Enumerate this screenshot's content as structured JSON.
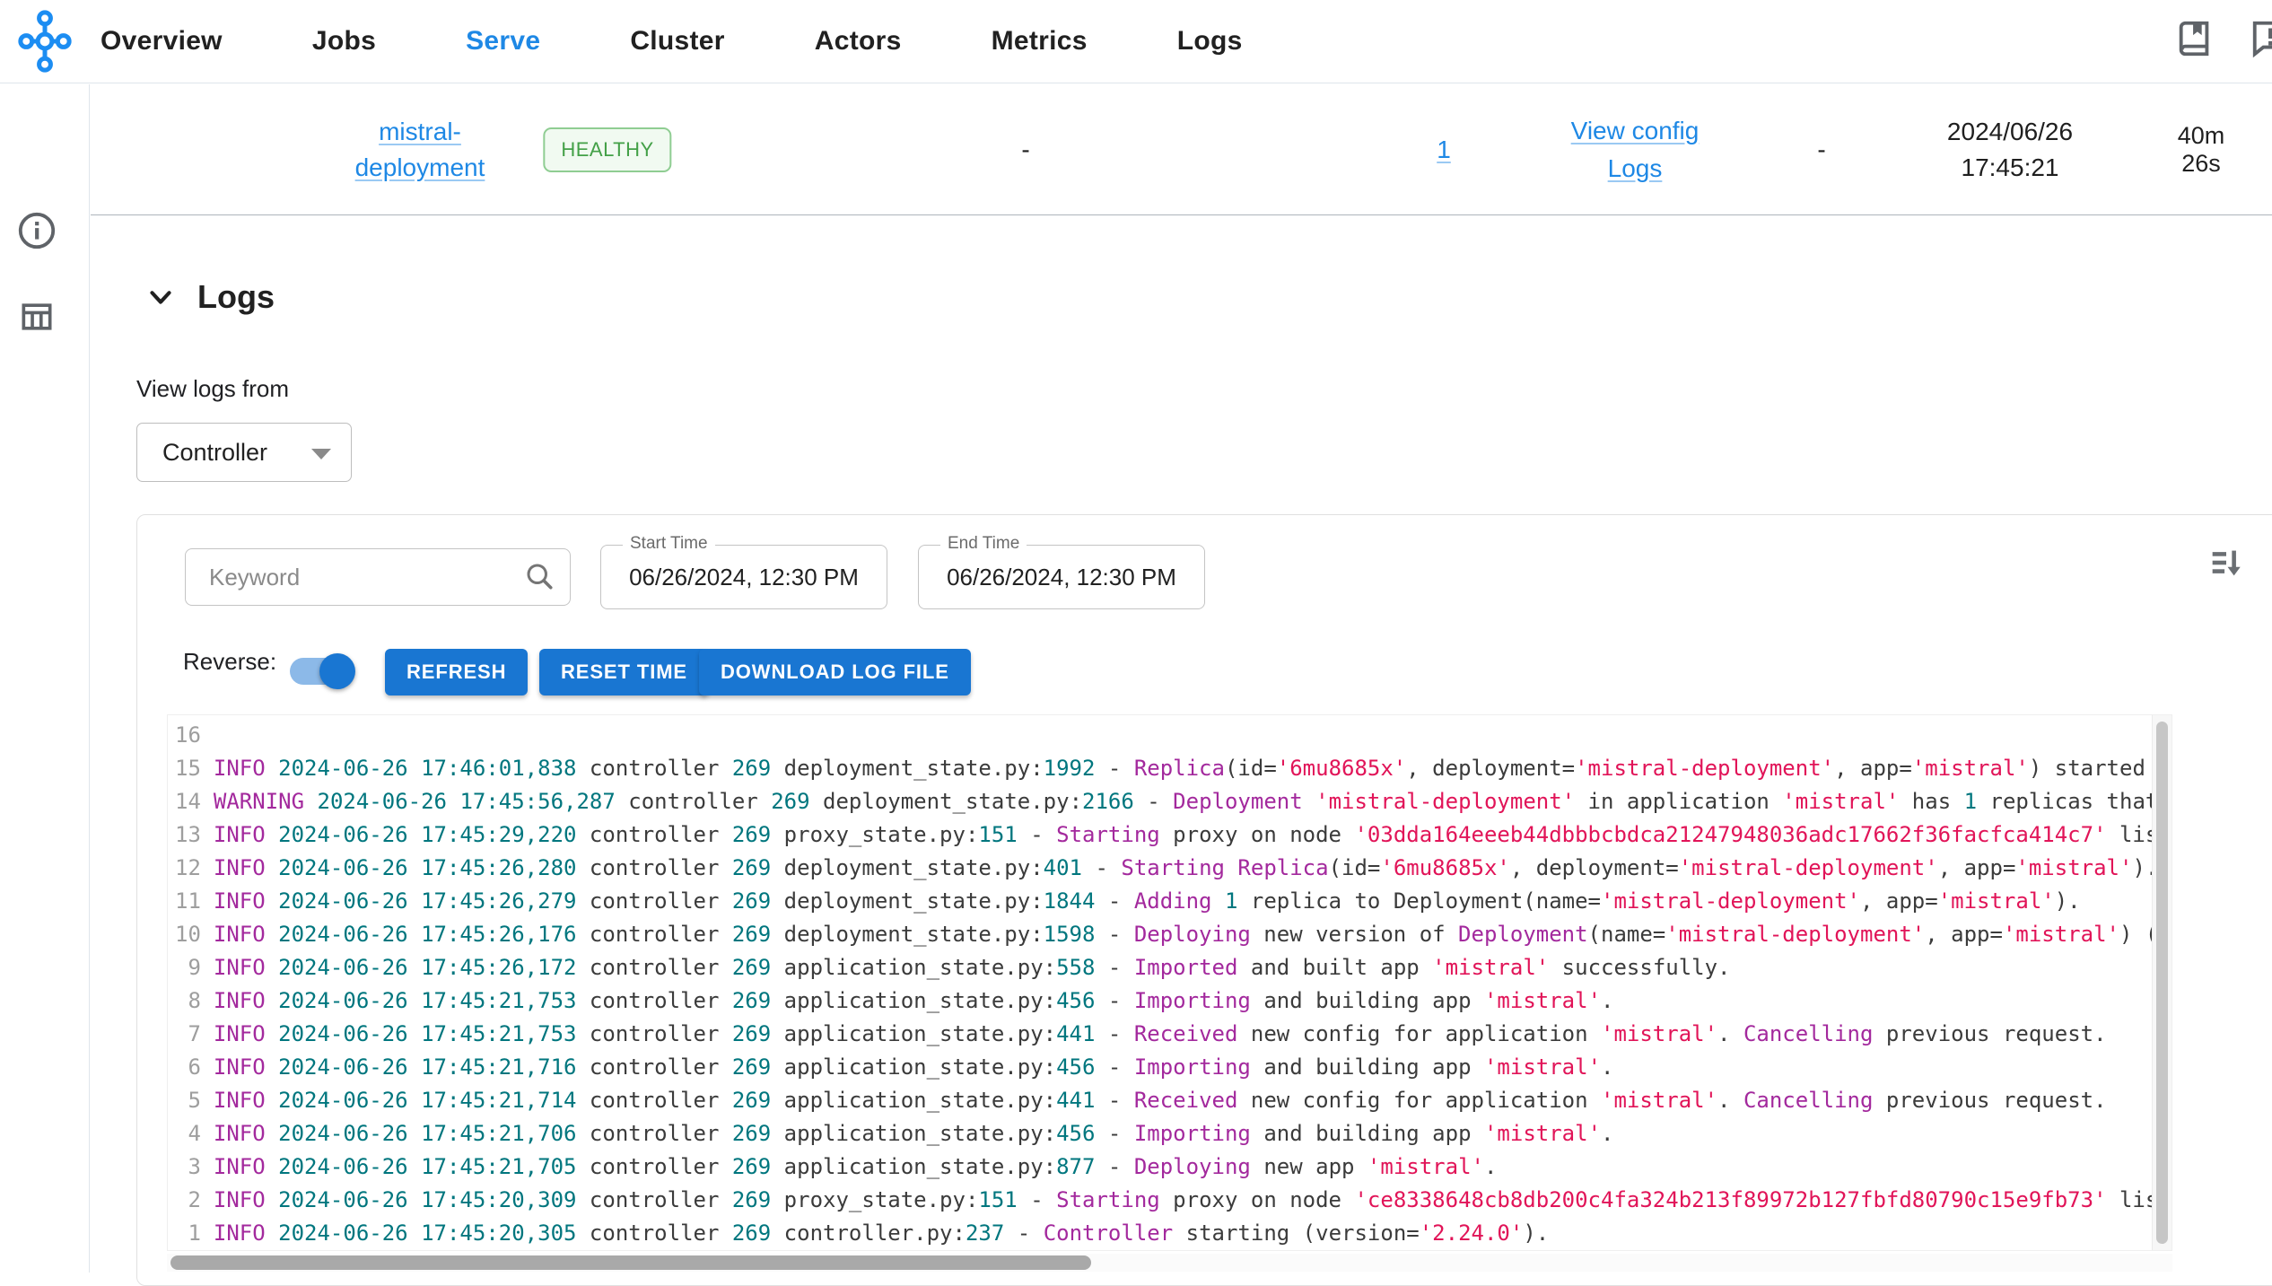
{
  "theme": {
    "accent": "#1976d2",
    "link": "#1e88e5",
    "healthy": "#43a047",
    "icon": "#5f6368",
    "logo": "#1c8df2",
    "magenta": "#a3299d",
    "teal": "#00767e",
    "string": "#e11458",
    "logtext": "#3b3b3b",
    "linenum": "#9e9e9e"
  },
  "nav": {
    "items": [
      {
        "label": "Overview"
      },
      {
        "label": "Jobs"
      },
      {
        "label": "Serve"
      },
      {
        "label": "Cluster"
      },
      {
        "label": "Actors"
      },
      {
        "label": "Metrics"
      },
      {
        "label": "Logs"
      }
    ],
    "active": "Serve"
  },
  "deployment_row": {
    "name": "mistral-deployment",
    "status": "HEALTHY",
    "status_message": "-",
    "replicas": "1",
    "action_view_config": "View config",
    "action_logs": "Logs",
    "col_dash": "-",
    "started_at": "2024/06/26 17:45:21",
    "duration": "40m 26s"
  },
  "logs_section": {
    "title": "Logs",
    "view_logs_from_label": "View logs from",
    "source_selected": "Controller"
  },
  "log_panel": {
    "keyword_placeholder": "Keyword",
    "start_time_label": "Start Time",
    "start_time_value": "06/26/2024, 12:30 PM",
    "end_time_label": "End Time",
    "end_time_value": "06/26/2024, 12:30 PM",
    "reverse_label": "Reverse:",
    "reverse_on": true,
    "refresh_label": "REFRESH",
    "reset_time_label": "RESET TIME",
    "download_label": "DOWNLOAD LOG FILE",
    "lines": [
      {
        "num": 16,
        "tokens": []
      },
      {
        "num": 15,
        "tokens": [
          [
            "m",
            "INFO"
          ],
          [
            "t",
            " 2024-06-26 17:46:01,838"
          ],
          [
            "n",
            " controller "
          ],
          [
            "t",
            "269"
          ],
          [
            "n",
            " deployment_state.py:"
          ],
          [
            "t",
            "1992"
          ],
          [
            "n",
            " - "
          ],
          [
            "m",
            "Replica"
          ],
          [
            "n",
            "(id="
          ],
          [
            "s",
            "'6mu8685x'"
          ],
          [
            "n",
            ", deployment="
          ],
          [
            "s",
            "'mistral-deployment'"
          ],
          [
            "n",
            ", app="
          ],
          [
            "s",
            "'mistral'"
          ],
          [
            "n",
            ") started su"
          ]
        ]
      },
      {
        "num": 14,
        "tokens": [
          [
            "m",
            "WARNING"
          ],
          [
            "t",
            " 2024-06-26 17:45:56,287"
          ],
          [
            "n",
            " controller "
          ],
          [
            "t",
            "269"
          ],
          [
            "n",
            " deployment_state.py:"
          ],
          [
            "t",
            "2166"
          ],
          [
            "n",
            " - "
          ],
          [
            "m",
            "Deployment"
          ],
          [
            "n",
            " "
          ],
          [
            "s",
            "'mistral-deployment'"
          ],
          [
            "n",
            " in application "
          ],
          [
            "s",
            "'mistral'"
          ],
          [
            "n",
            " has "
          ],
          [
            "t",
            "1"
          ],
          [
            "n",
            " replicas that"
          ]
        ]
      },
      {
        "num": 13,
        "tokens": [
          [
            "m",
            "INFO"
          ],
          [
            "t",
            " 2024-06-26 17:45:29,220"
          ],
          [
            "n",
            " controller "
          ],
          [
            "t",
            "269"
          ],
          [
            "n",
            " proxy_state.py:"
          ],
          [
            "t",
            "151"
          ],
          [
            "n",
            " - "
          ],
          [
            "m",
            "Starting"
          ],
          [
            "n",
            " proxy on node "
          ],
          [
            "s",
            "'03dda164eeeb44dbbbcbdca21247948036adc17662f36facfca414c7'"
          ],
          [
            "n",
            " lis"
          ]
        ]
      },
      {
        "num": 12,
        "tokens": [
          [
            "m",
            "INFO"
          ],
          [
            "t",
            " 2024-06-26 17:45:26,280"
          ],
          [
            "n",
            " controller "
          ],
          [
            "t",
            "269"
          ],
          [
            "n",
            " deployment_state.py:"
          ],
          [
            "t",
            "401"
          ],
          [
            "n",
            " - "
          ],
          [
            "m",
            "Starting"
          ],
          [
            "n",
            " "
          ],
          [
            "m",
            "Replica"
          ],
          [
            "n",
            "(id="
          ],
          [
            "s",
            "'6mu8685x'"
          ],
          [
            "n",
            ", deployment="
          ],
          [
            "s",
            "'mistral-deployment'"
          ],
          [
            "n",
            ", app="
          ],
          [
            "s",
            "'mistral'"
          ],
          [
            "n",
            ")."
          ]
        ]
      },
      {
        "num": 11,
        "tokens": [
          [
            "m",
            "INFO"
          ],
          [
            "t",
            " 2024-06-26 17:45:26,279"
          ],
          [
            "n",
            " controller "
          ],
          [
            "t",
            "269"
          ],
          [
            "n",
            " deployment_state.py:"
          ],
          [
            "t",
            "1844"
          ],
          [
            "n",
            " - "
          ],
          [
            "m",
            "Adding"
          ],
          [
            "n",
            " "
          ],
          [
            "t",
            "1"
          ],
          [
            "n",
            " replica to Deployment(name="
          ],
          [
            "s",
            "'mistral-deployment'"
          ],
          [
            "n",
            ", app="
          ],
          [
            "s",
            "'mistral'"
          ],
          [
            "n",
            ")."
          ]
        ]
      },
      {
        "num": 10,
        "tokens": [
          [
            "m",
            "INFO"
          ],
          [
            "t",
            " 2024-06-26 17:45:26,176"
          ],
          [
            "n",
            " controller "
          ],
          [
            "t",
            "269"
          ],
          [
            "n",
            " deployment_state.py:"
          ],
          [
            "t",
            "1598"
          ],
          [
            "n",
            " - "
          ],
          [
            "m",
            "Deploying"
          ],
          [
            "n",
            " new version of "
          ],
          [
            "m",
            "Deployment"
          ],
          [
            "n",
            "(name="
          ],
          [
            "s",
            "'mistral-deployment'"
          ],
          [
            "n",
            ", app="
          ],
          [
            "s",
            "'mistral'"
          ],
          [
            "n",
            ") ("
          ]
        ]
      },
      {
        "num": 9,
        "tokens": [
          [
            "m",
            "INFO"
          ],
          [
            "t",
            " 2024-06-26 17:45:26,172"
          ],
          [
            "n",
            " controller "
          ],
          [
            "t",
            "269"
          ],
          [
            "n",
            " application_state.py:"
          ],
          [
            "t",
            "558"
          ],
          [
            "n",
            " - "
          ],
          [
            "m",
            "Imported"
          ],
          [
            "n",
            " and built app "
          ],
          [
            "s",
            "'mistral'"
          ],
          [
            "n",
            " successfully."
          ]
        ]
      },
      {
        "num": 8,
        "tokens": [
          [
            "m",
            "INFO"
          ],
          [
            "t",
            " 2024-06-26 17:45:21,753"
          ],
          [
            "n",
            " controller "
          ],
          [
            "t",
            "269"
          ],
          [
            "n",
            " application_state.py:"
          ],
          [
            "t",
            "456"
          ],
          [
            "n",
            " - "
          ],
          [
            "m",
            "Importing"
          ],
          [
            "n",
            " and building app "
          ],
          [
            "s",
            "'mistral'"
          ],
          [
            "n",
            "."
          ]
        ]
      },
      {
        "num": 7,
        "tokens": [
          [
            "m",
            "INFO"
          ],
          [
            "t",
            " 2024-06-26 17:45:21,753"
          ],
          [
            "n",
            " controller "
          ],
          [
            "t",
            "269"
          ],
          [
            "n",
            " application_state.py:"
          ],
          [
            "t",
            "441"
          ],
          [
            "n",
            " - "
          ],
          [
            "m",
            "Received"
          ],
          [
            "n",
            " new config for application "
          ],
          [
            "s",
            "'mistral'"
          ],
          [
            "n",
            ". "
          ],
          [
            "m",
            "Cancelling"
          ],
          [
            "n",
            " previous request."
          ]
        ]
      },
      {
        "num": 6,
        "tokens": [
          [
            "m",
            "INFO"
          ],
          [
            "t",
            " 2024-06-26 17:45:21,716"
          ],
          [
            "n",
            " controller "
          ],
          [
            "t",
            "269"
          ],
          [
            "n",
            " application_state.py:"
          ],
          [
            "t",
            "456"
          ],
          [
            "n",
            " - "
          ],
          [
            "m",
            "Importing"
          ],
          [
            "n",
            " and building app "
          ],
          [
            "s",
            "'mistral'"
          ],
          [
            "n",
            "."
          ]
        ]
      },
      {
        "num": 5,
        "tokens": [
          [
            "m",
            "INFO"
          ],
          [
            "t",
            " 2024-06-26 17:45:21,714"
          ],
          [
            "n",
            " controller "
          ],
          [
            "t",
            "269"
          ],
          [
            "n",
            " application_state.py:"
          ],
          [
            "t",
            "441"
          ],
          [
            "n",
            " - "
          ],
          [
            "m",
            "Received"
          ],
          [
            "n",
            " new config for application "
          ],
          [
            "s",
            "'mistral'"
          ],
          [
            "n",
            ". "
          ],
          [
            "m",
            "Cancelling"
          ],
          [
            "n",
            " previous request."
          ]
        ]
      },
      {
        "num": 4,
        "tokens": [
          [
            "m",
            "INFO"
          ],
          [
            "t",
            " 2024-06-26 17:45:21,706"
          ],
          [
            "n",
            " controller "
          ],
          [
            "t",
            "269"
          ],
          [
            "n",
            " application_state.py:"
          ],
          [
            "t",
            "456"
          ],
          [
            "n",
            " - "
          ],
          [
            "m",
            "Importing"
          ],
          [
            "n",
            " and building app "
          ],
          [
            "s",
            "'mistral'"
          ],
          [
            "n",
            "."
          ]
        ]
      },
      {
        "num": 3,
        "tokens": [
          [
            "m",
            "INFO"
          ],
          [
            "t",
            " 2024-06-26 17:45:21,705"
          ],
          [
            "n",
            " controller "
          ],
          [
            "t",
            "269"
          ],
          [
            "n",
            " application_state.py:"
          ],
          [
            "t",
            "877"
          ],
          [
            "n",
            " - "
          ],
          [
            "m",
            "Deploying"
          ],
          [
            "n",
            " new app "
          ],
          [
            "s",
            "'mistral'"
          ],
          [
            "n",
            "."
          ]
        ]
      },
      {
        "num": 2,
        "tokens": [
          [
            "m",
            "INFO"
          ],
          [
            "t",
            " 2024-06-26 17:45:20,309"
          ],
          [
            "n",
            " controller "
          ],
          [
            "t",
            "269"
          ],
          [
            "n",
            " proxy_state.py:"
          ],
          [
            "t",
            "151"
          ],
          [
            "n",
            " - "
          ],
          [
            "m",
            "Starting"
          ],
          [
            "n",
            " proxy on node "
          ],
          [
            "s",
            "'ce8338648cb8db200c4fa324b213f89972b127fbfd80790c15e9fb73'"
          ],
          [
            "n",
            " lis"
          ]
        ]
      },
      {
        "num": 1,
        "tokens": [
          [
            "m",
            "INFO"
          ],
          [
            "t",
            " 2024-06-26 17:45:20,305"
          ],
          [
            "n",
            " controller "
          ],
          [
            "t",
            "269"
          ],
          [
            "n",
            " controller.py:"
          ],
          [
            "t",
            "237"
          ],
          [
            "n",
            " - "
          ],
          [
            "m",
            "Controller"
          ],
          [
            "n",
            " starting (version="
          ],
          [
            "s",
            "'2.24.0'"
          ],
          [
            "n",
            ")."
          ]
        ]
      }
    ]
  }
}
